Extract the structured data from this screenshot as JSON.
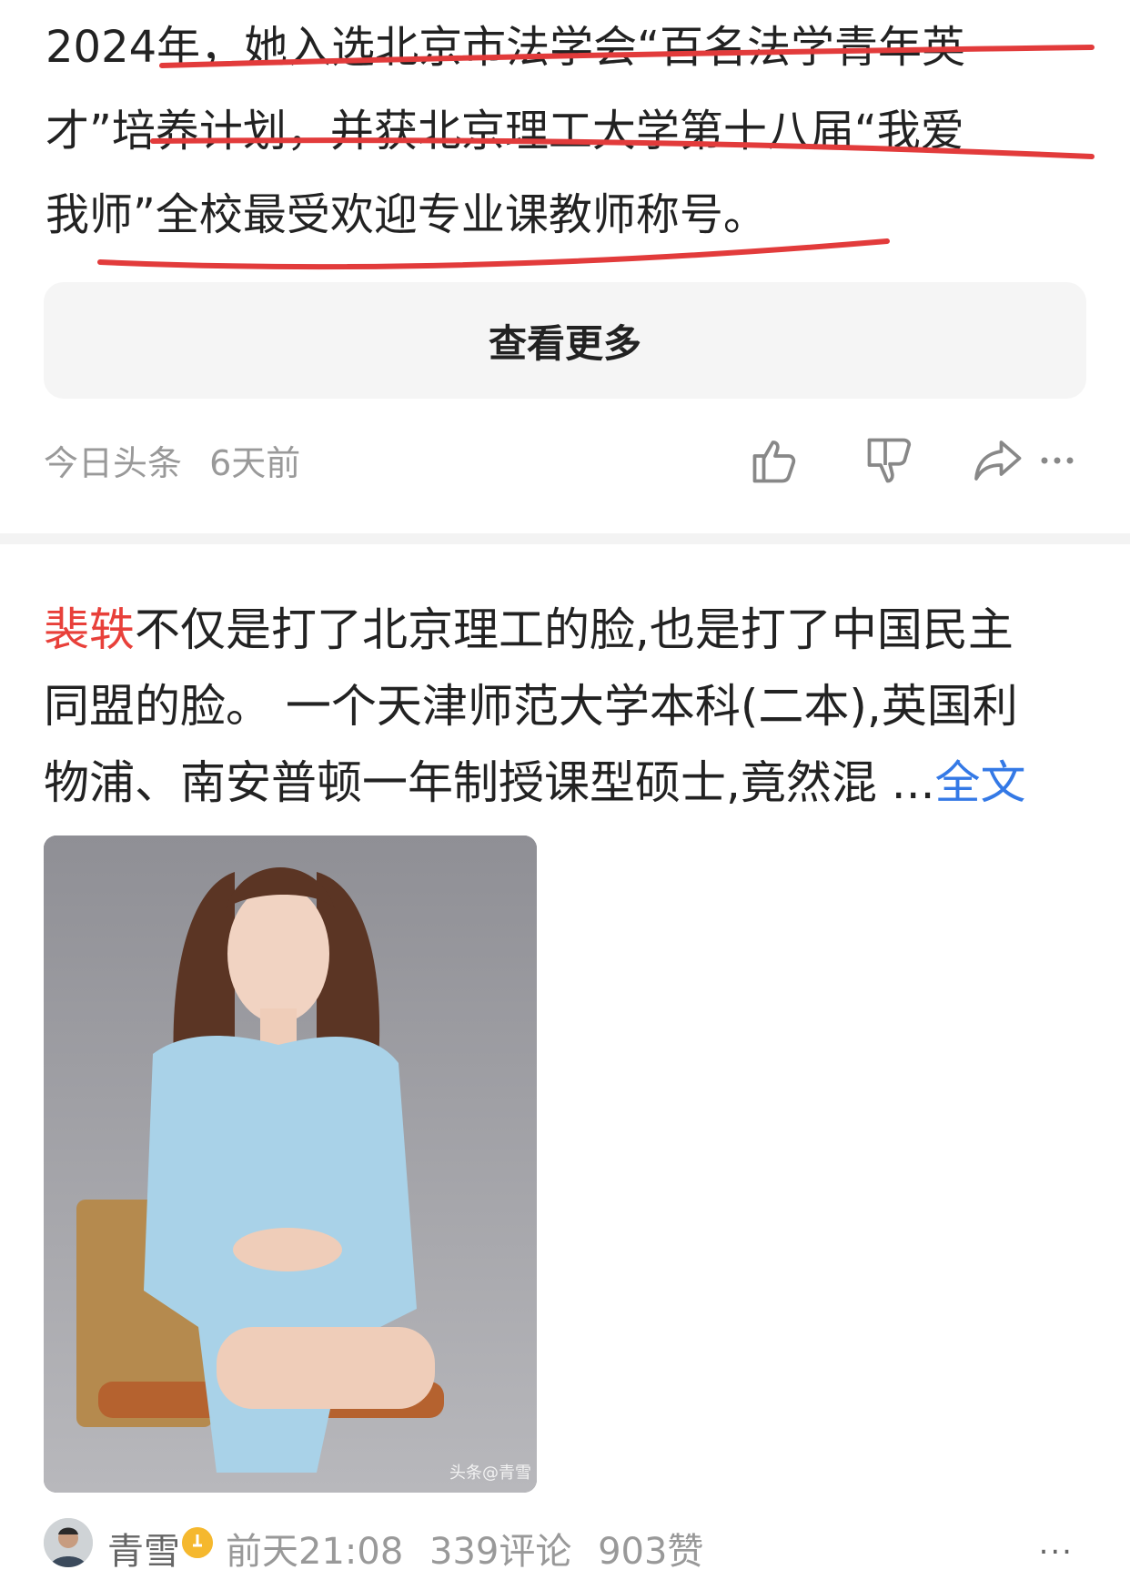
{
  "article_card": {
    "body_lines": [
      "2024年，她入选北京市法学会“百名法学青年英",
      "才”培养计划，并获北京理工大学第十八届“我爱",
      "我师”全校最受欢迎专业课教师称号。"
    ],
    "more_button_label": "查看更多",
    "source": "今日头条",
    "time": "6天前",
    "underline_color": "#e23b3b"
  },
  "post_card": {
    "author_highlight": "裴轶",
    "line1_rest": "不仅是打了北京理工的脸,也是打了中国民主",
    "line2": "同盟的脸。 一个天津师范大学本科(二本),英国利",
    "line3": "物浦、南安普顿一年制授课型硕士,竟然混",
    "ellipsis": " ...",
    "read_more": "全文",
    "image_watermark": "头条@青雪",
    "author": "青雪",
    "time": "前天21:08",
    "comments": "339评论",
    "likes": "903赞",
    "more_icon": "..."
  },
  "icons": [
    "thumbs-up-icon",
    "thumbs-down-icon",
    "share-icon",
    "more-icon",
    "verified-badge-icon"
  ],
  "colors": {
    "author_highlight": "#e8403a",
    "read_more": "#3479e6",
    "meta_text": "#999999"
  }
}
